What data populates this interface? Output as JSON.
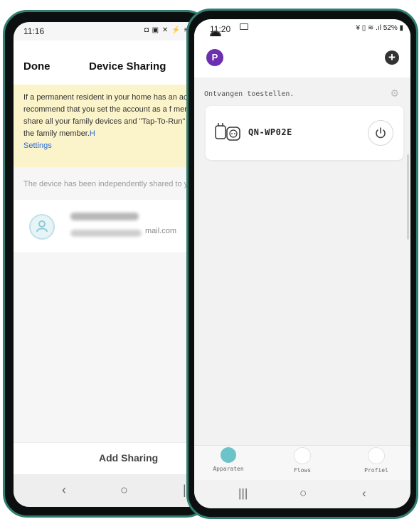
{
  "left_phone": {
    "status": {
      "time": "11:16",
      "icons": "◘ ▣   ✕ ⚡ ≋ .."
    },
    "header": {
      "done_label": "Done",
      "title": "Device Sharing"
    },
    "banner": {
      "text": "If a permanent resident in your home has an ac we recommend that you set the account as a f member and share all your family devices and \"Tap-To-Run\" Scene with the family member.",
      "link_fragment": "H",
      "settings_link": "Settings"
    },
    "shared_note": "The device has been independently shared to y",
    "member": {
      "email_suffix": "mail.com"
    },
    "add_sharing_label": "Add Sharing",
    "nav": {
      "back": "‹",
      "home": "○",
      "recent": "|||"
    }
  },
  "right_phone": {
    "status": {
      "time": "11:20",
      "icons": "¥ ▯ ≋ .ıl 52% ▮"
    },
    "header": {
      "avatar_letter": "P",
      "add_glyph": "+"
    },
    "section_label": "Ontvangen toestellen.",
    "gear_glyph": "⚙",
    "device": {
      "name": "QN-WP02E"
    },
    "tabs": [
      {
        "label": "Apparaten",
        "active": true
      },
      {
        "label": "Flows",
        "active": false
      },
      {
        "label": "Profiel",
        "active": false
      }
    ],
    "nav": {
      "recent": "|||",
      "home": "○",
      "back": "‹"
    },
    "colors": {
      "accent": "#6cc3c9",
      "avatar": "#6b2fb0"
    }
  }
}
